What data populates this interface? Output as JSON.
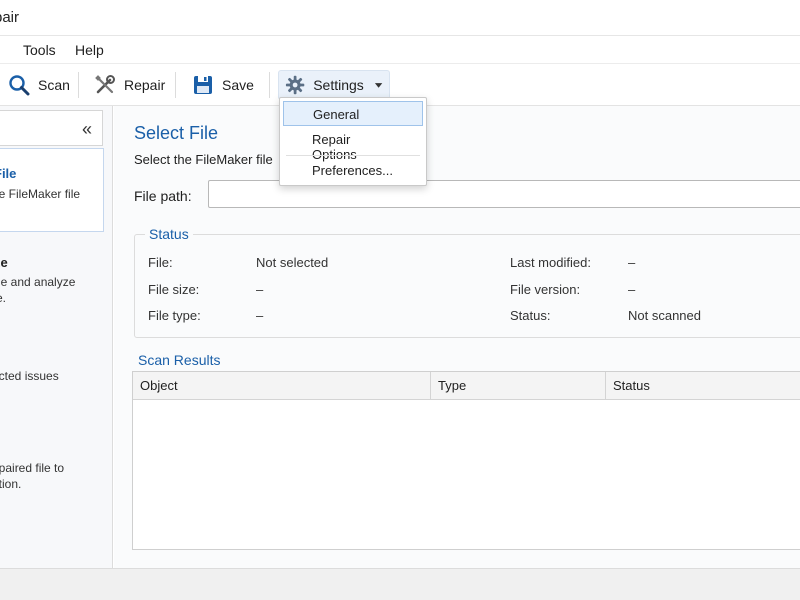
{
  "window": {
    "title": "pair"
  },
  "menubar": {
    "items": [
      "Tools",
      "Help"
    ]
  },
  "toolbar": {
    "scan_label": "Scan",
    "repair_label": "Repair",
    "save_label": "Save",
    "settings_label": "Settings"
  },
  "settings_menu": {
    "items": [
      "General",
      "Repair Options",
      "Preferences..."
    ]
  },
  "sidebar": {
    "collapse_glyph": "«",
    "steps": [
      {
        "title": "File",
        "desc": "he FileMaker file"
      },
      {
        "title": "ze",
        "desc": "file and analyze\nre."
      },
      {
        "title": "",
        "desc": "ected issues"
      },
      {
        "title": "",
        "desc": "epaired file to\nation."
      }
    ]
  },
  "main": {
    "title": "Select File",
    "subtitle": "Select the FileMaker file",
    "file_path_label": "File path:",
    "file_path_value": "",
    "status": {
      "title": "Status",
      "file_label": "File:",
      "file_value": "Not selected",
      "size_label": "File size:",
      "size_value": "–",
      "type_label": "File type:",
      "type_value": "–",
      "modified_label": "Last modified:",
      "modified_value": "–",
      "version_label": "File version:",
      "version_value": "–",
      "status_label": "Status:",
      "status_value": "Not scanned"
    },
    "results": {
      "title": "Scan Results",
      "columns": [
        "Object",
        "Type",
        "Status"
      ]
    }
  },
  "colors": {
    "accent": "#1a5fa8",
    "menu_highlight": "#e5f0fc"
  },
  "icons": {
    "scan": "magnifier-icon",
    "repair": "tools-icon",
    "save": "floppy-icon",
    "settings": "gear-icon",
    "dropdown": "caret-down-icon"
  }
}
